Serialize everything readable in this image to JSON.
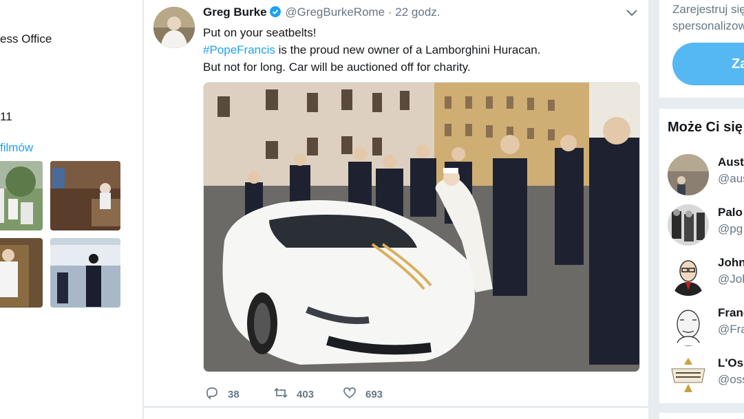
{
  "left": {
    "office_text": "ess Office",
    "count_text": "11",
    "media_link": "filmów"
  },
  "tweet": {
    "name": "Greg Burke",
    "handle": "@GregBurkeRome",
    "separator": "·",
    "time": "22 godz.",
    "line1": "Put on your seatbelts!",
    "hashtag": "#PopeFrancis",
    "line2_rest": " is the proud new owner of a Lamborghini Huracan.",
    "line3": "But not for long. Car will be auctioned off for charity.",
    "replies": "38",
    "retweets": "403",
    "likes": "693"
  },
  "signup": {
    "line1": "Zarejestruj się",
    "line2": "spersonalizow",
    "button": "Za"
  },
  "who_to_follow": {
    "title": "Może Ci się",
    "items": [
      {
        "name": "Aust",
        "handle": "@aus"
      },
      {
        "name": "Palo",
        "handle": "@pg"
      },
      {
        "name": "John",
        "handle": "@Joh"
      },
      {
        "name": "Franc",
        "handle": "@Fra"
      },
      {
        "name": "L'Oss",
        "handle": "@oss"
      }
    ]
  },
  "colors": {
    "accent": "#1da1f2",
    "background": "#e6ecf0",
    "secondary_text": "#657786",
    "verified_badge": "#1da1f2"
  }
}
